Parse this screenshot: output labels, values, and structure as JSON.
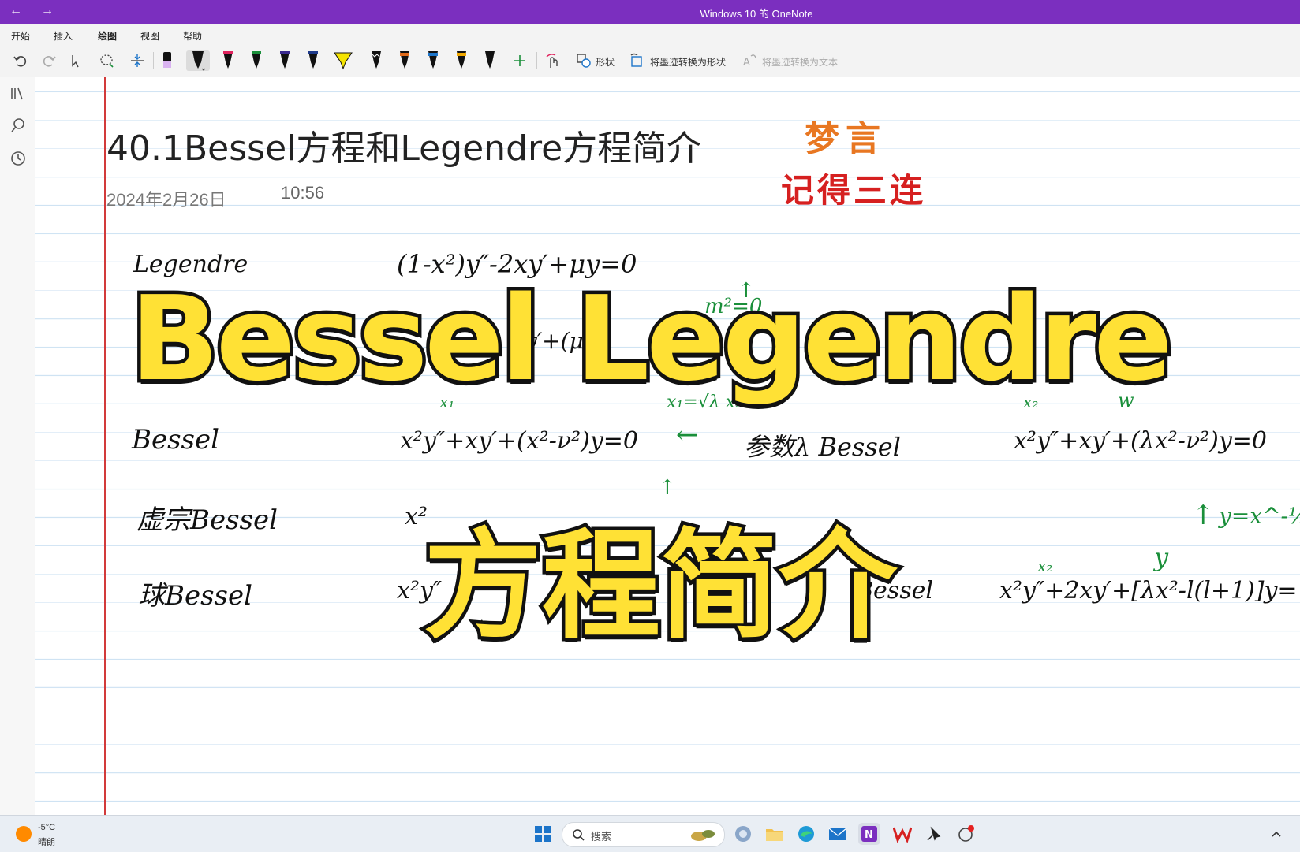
{
  "window": {
    "title": "Windows 10 的 OneNote",
    "back": "←",
    "forward": "→"
  },
  "menu": [
    "开始",
    "插入",
    "绘图",
    "视图",
    "帮助"
  ],
  "toolbar": {
    "shapes_label": "形状",
    "ink_to_shape_label": "将墨迹转换为形状",
    "ink_to_text_label": "将墨迹转换为文本"
  },
  "pens": [
    {
      "color": "#111111"
    },
    {
      "color": "#111111"
    },
    {
      "color": "#e0245e"
    },
    {
      "color": "#1a8f3a"
    },
    {
      "color": "#3a2a8f"
    },
    {
      "color": "#1e3a8a"
    },
    {
      "color": "#f5e400"
    },
    {
      "color": "#111111"
    },
    {
      "color": "#e06a1a"
    },
    {
      "color": "#1c74c9"
    },
    {
      "color": "#f0a800"
    },
    {
      "color": "#111111"
    }
  ],
  "page": {
    "title": "40.1Bessel方程和Legendre方程简介",
    "date": "2024年2月26日",
    "time": "10:56",
    "stamp1": "梦言",
    "stamp2": "记得三连"
  },
  "notes": {
    "legendre_label": "Legendre",
    "legendre_eq": "(1-x²)y″-2xy′+μy=0",
    "legendre_mid": "y′+(μ-",
    "legendre_green": "m²=0",
    "bessel_label": "Bessel",
    "bessel_eq": "x²y″+xy′+(x²-ν²)y=0",
    "arrow": "←",
    "param_label": "参数λ Bessel",
    "param_eq": "x²y″+xy′+(λx²-ν²)y=0",
    "xuzong_label": "虚宗Bessel",
    "xuzong_eq": "x²",
    "qiu_label": "球Bessel",
    "qiu_eq": "x²y″",
    "qiu_mid": "Bessel",
    "qiu_right_eq": "x²y″+2xy′+[λx²-l(l+1)]y=",
    "green_x1": "x₁",
    "green_sub": "x₁=√λ x₂",
    "green_x2": "x₂",
    "green_w": "w",
    "green_yx": "y=x^-½ u",
    "green_x1b": "x₁",
    "green_y": "y",
    "green_x2b": "x₂"
  },
  "overlay": {
    "line1": "Bessel Legendre",
    "line2": "方程简介"
  },
  "taskbar": {
    "temp": "-5°C",
    "condition": "晴朗",
    "search_placeholder": "搜索"
  }
}
